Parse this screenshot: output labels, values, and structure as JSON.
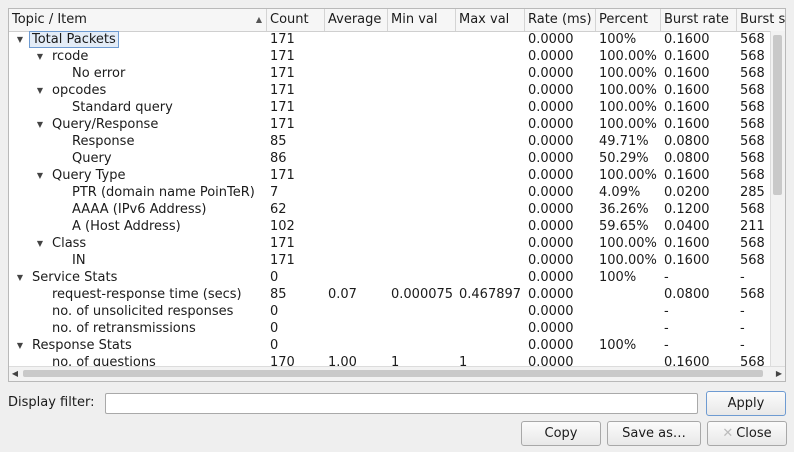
{
  "columns": [
    "Topic / Item",
    "Count",
    "Average",
    "Min val",
    "Max val",
    "Rate (ms)",
    "Percent",
    "Burst rate",
    "Burst start"
  ],
  "rows": [
    {
      "topic": "Total Packets",
      "count": "171",
      "average": "",
      "min": "",
      "max": "",
      "rate": "0.0000",
      "percent": "100%",
      "burst_rate": "0.1600",
      "burst_start": "568",
      "level": 0,
      "expanded": true,
      "selected": true
    },
    {
      "topic": "rcode",
      "count": "171",
      "average": "",
      "min": "",
      "max": "",
      "rate": "0.0000",
      "percent": "100.00%",
      "burst_rate": "0.1600",
      "burst_start": "568",
      "level": 1,
      "expanded": true
    },
    {
      "topic": "No error",
      "count": "171",
      "average": "",
      "min": "",
      "max": "",
      "rate": "0.0000",
      "percent": "100.00%",
      "burst_rate": "0.1600",
      "burst_start": "568",
      "level": 2
    },
    {
      "topic": "opcodes",
      "count": "171",
      "average": "",
      "min": "",
      "max": "",
      "rate": "0.0000",
      "percent": "100.00%",
      "burst_rate": "0.1600",
      "burst_start": "568",
      "level": 1,
      "expanded": true
    },
    {
      "topic": "Standard query",
      "count": "171",
      "average": "",
      "min": "",
      "max": "",
      "rate": "0.0000",
      "percent": "100.00%",
      "burst_rate": "0.1600",
      "burst_start": "568",
      "level": 2
    },
    {
      "topic": "Query/Response",
      "count": "171",
      "average": "",
      "min": "",
      "max": "",
      "rate": "0.0000",
      "percent": "100.00%",
      "burst_rate": "0.1600",
      "burst_start": "568",
      "level": 1,
      "expanded": true
    },
    {
      "topic": "Response",
      "count": "85",
      "average": "",
      "min": "",
      "max": "",
      "rate": "0.0000",
      "percent": "49.71%",
      "burst_rate": "0.0800",
      "burst_start": "568",
      "level": 2
    },
    {
      "topic": "Query",
      "count": "86",
      "average": "",
      "min": "",
      "max": "",
      "rate": "0.0000",
      "percent": "50.29%",
      "burst_rate": "0.0800",
      "burst_start": "568",
      "level": 2
    },
    {
      "topic": "Query Type",
      "count": "171",
      "average": "",
      "min": "",
      "max": "",
      "rate": "0.0000",
      "percent": "100.00%",
      "burst_rate": "0.1600",
      "burst_start": "568",
      "level": 1,
      "expanded": true
    },
    {
      "topic": "PTR (domain name PoinTeR)",
      "count": "7",
      "average": "",
      "min": "",
      "max": "",
      "rate": "0.0000",
      "percent": "4.09%",
      "burst_rate": "0.0200",
      "burst_start": "285",
      "level": 2
    },
    {
      "topic": "AAAA (IPv6 Address)",
      "count": "62",
      "average": "",
      "min": "",
      "max": "",
      "rate": "0.0000",
      "percent": "36.26%",
      "burst_rate": "0.1200",
      "burst_start": "568",
      "level": 2
    },
    {
      "topic": "A (Host Address)",
      "count": "102",
      "average": "",
      "min": "",
      "max": "",
      "rate": "0.0000",
      "percent": "59.65%",
      "burst_rate": "0.0400",
      "burst_start": "211",
      "level": 2
    },
    {
      "topic": "Class",
      "count": "171",
      "average": "",
      "min": "",
      "max": "",
      "rate": "0.0000",
      "percent": "100.00%",
      "burst_rate": "0.1600",
      "burst_start": "568",
      "level": 1,
      "expanded": true
    },
    {
      "topic": "IN",
      "count": "171",
      "average": "",
      "min": "",
      "max": "",
      "rate": "0.0000",
      "percent": "100.00%",
      "burst_rate": "0.1600",
      "burst_start": "568",
      "level": 2
    },
    {
      "topic": "Service Stats",
      "count": "0",
      "average": "",
      "min": "",
      "max": "",
      "rate": "0.0000",
      "percent": "100%",
      "burst_rate": "-",
      "burst_start": "-",
      "level": 0,
      "expanded": true
    },
    {
      "topic": "request-response time (secs)",
      "count": "85",
      "average": "0.07",
      "min": "0.000075",
      "max": "0.467897",
      "rate": "0.0000",
      "percent": "",
      "burst_rate": "0.0800",
      "burst_start": "568",
      "level": 1
    },
    {
      "topic": "no. of unsolicited responses",
      "count": "0",
      "average": "",
      "min": "",
      "max": "",
      "rate": "0.0000",
      "percent": "",
      "burst_rate": "-",
      "burst_start": "-",
      "level": 1
    },
    {
      "topic": "no. of retransmissions",
      "count": "0",
      "average": "",
      "min": "",
      "max": "",
      "rate": "0.0000",
      "percent": "",
      "burst_rate": "-",
      "burst_start": "-",
      "level": 1
    },
    {
      "topic": "Response Stats",
      "count": "0",
      "average": "",
      "min": "",
      "max": "",
      "rate": "0.0000",
      "percent": "100%",
      "burst_rate": "-",
      "burst_start": "-",
      "level": 0,
      "expanded": true
    },
    {
      "topic": "no. of questions",
      "count": "170",
      "average": "1.00",
      "min": "1",
      "max": "1",
      "rate": "0.0000",
      "percent": "",
      "burst_rate": "0.1600",
      "burst_start": "568",
      "level": 1
    }
  ],
  "filter": {
    "label": "Display filter:",
    "value": ""
  },
  "buttons": {
    "apply": "Apply",
    "copy": "Copy",
    "save_as": "Save as…",
    "close": "Close"
  },
  "colors": {
    "selection_bg": "#e3ecf7",
    "selection_border": "#6e9bd2"
  }
}
